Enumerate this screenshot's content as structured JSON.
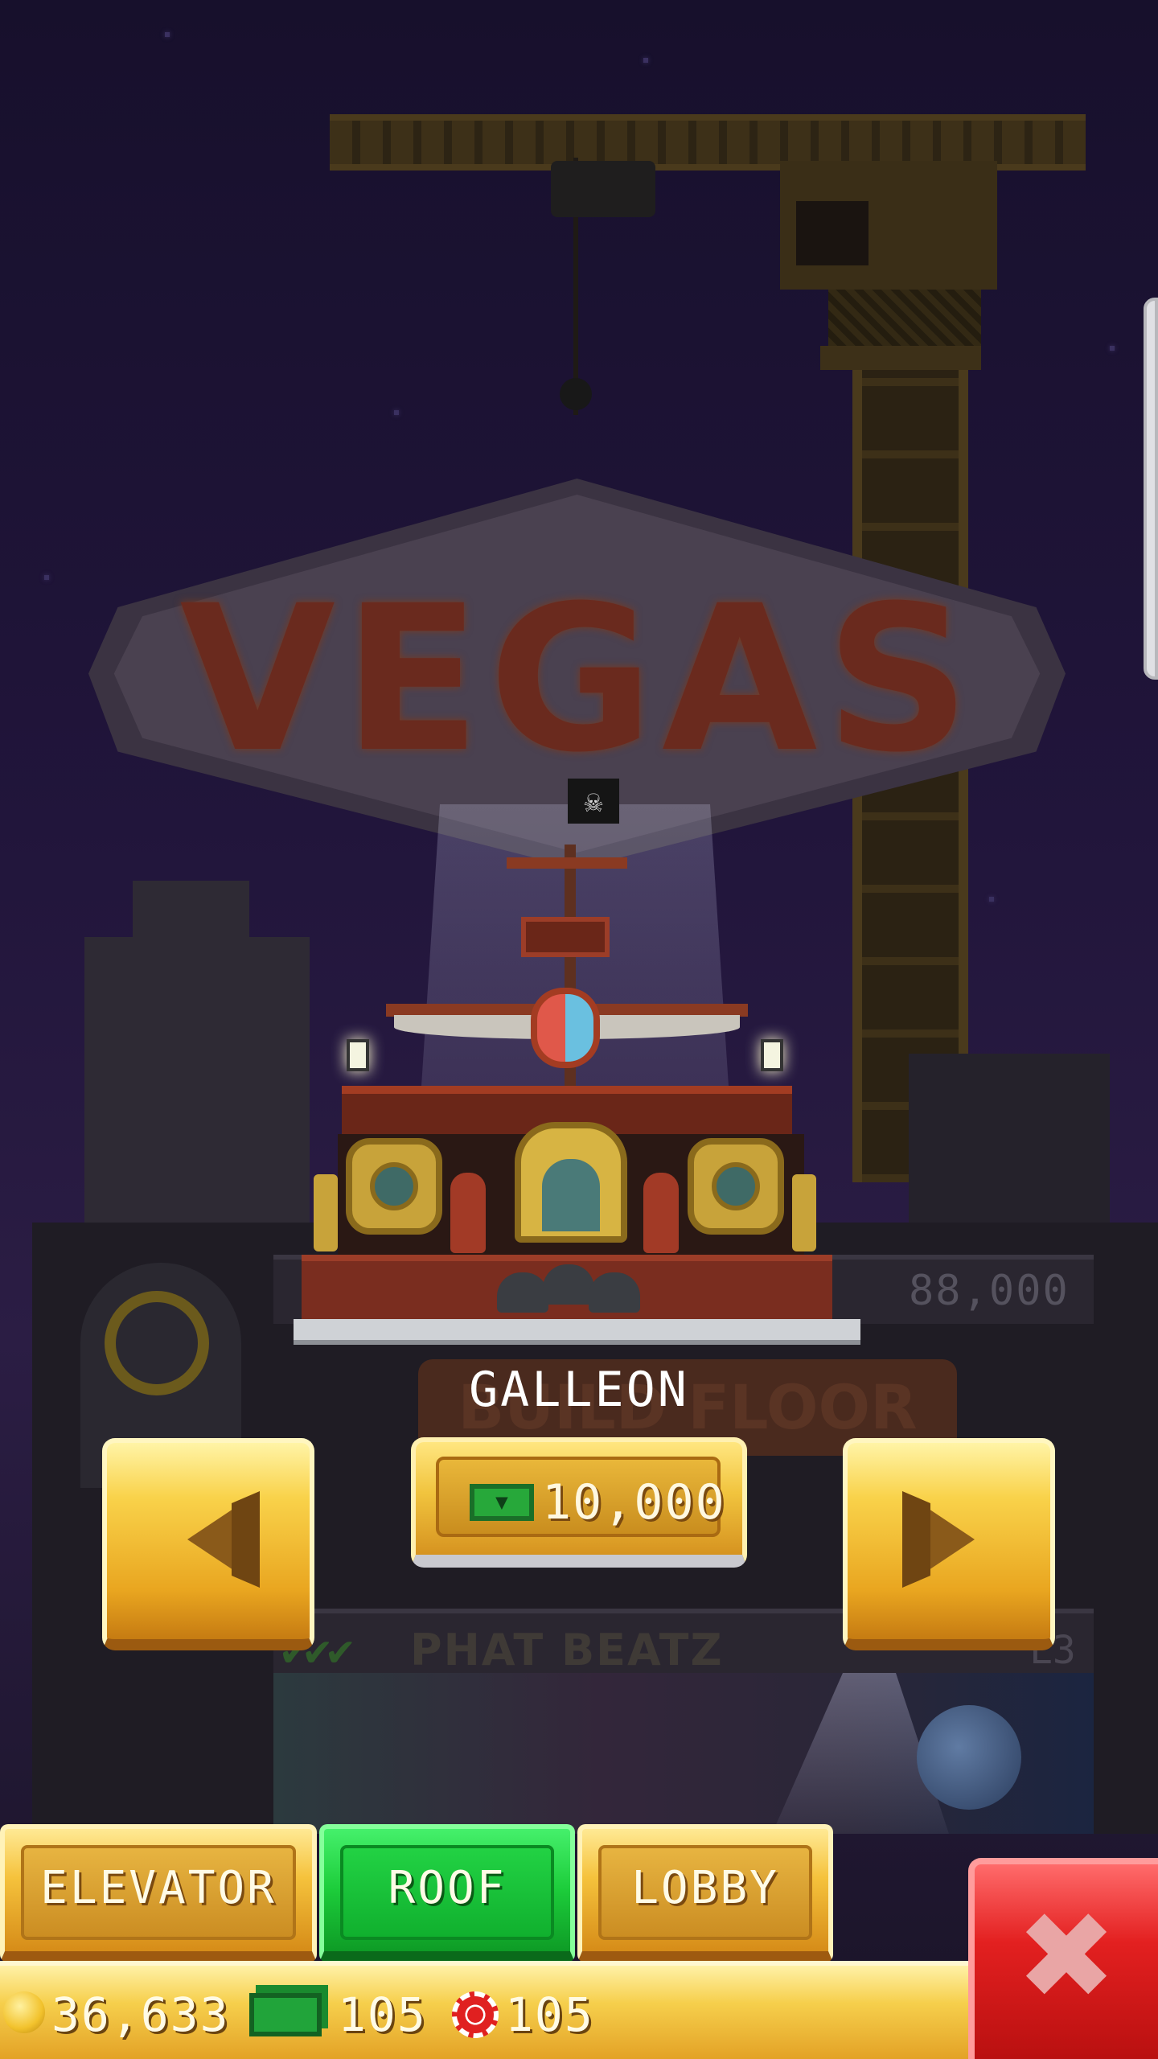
{
  "background": {
    "sign_text": "VEGAS",
    "floor_price": "88,000",
    "build_floor_label": "BUILD FLOOR",
    "floor_name": "PHAT BEATZ",
    "floor_level": "L3",
    "flag_icon": "skull-flag-icon"
  },
  "roof_selector": {
    "roof_name": "GALLEON",
    "price": "10,000",
    "price_currency_icon": "bux-icon",
    "prev_icon": "arrow-left-icon",
    "next_icon": "arrow-right-icon"
  },
  "tabs": [
    {
      "label": "ELEVATOR",
      "active": false
    },
    {
      "label": "ROOF",
      "active": true
    },
    {
      "label": "LOBBY",
      "active": false
    }
  ],
  "close_icon": "close-x-icon",
  "status": {
    "coins": "36,633",
    "bux": "105",
    "chips": "105"
  },
  "colors": {
    "gold": "#f5c23c",
    "active_tab": "#1ccc3a",
    "close": "#e32020",
    "sky": "#21153b"
  }
}
